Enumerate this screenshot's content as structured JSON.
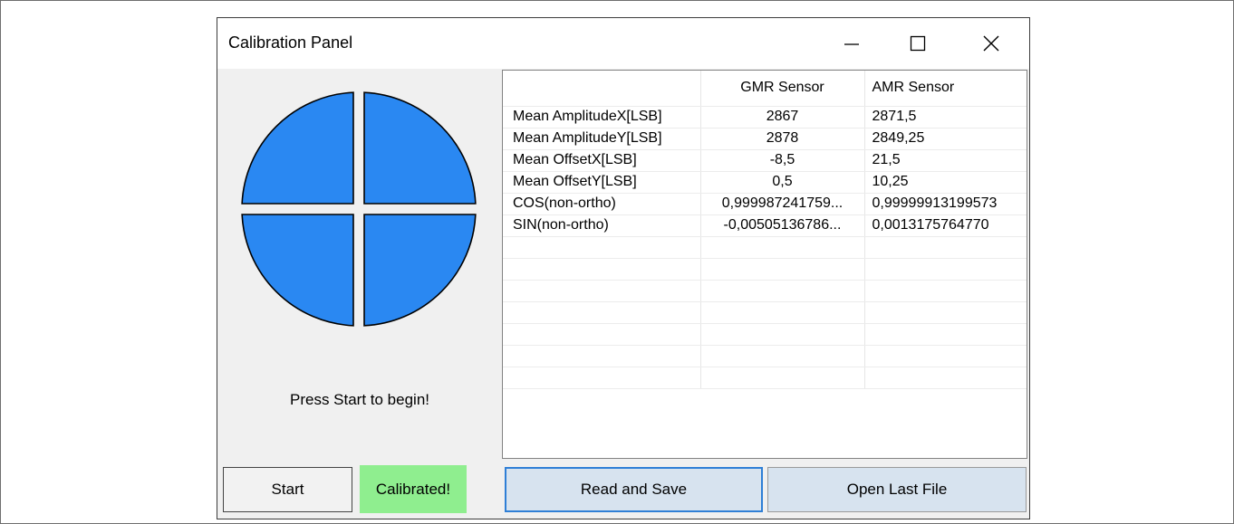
{
  "window": {
    "title": "Calibration Panel",
    "controls": [
      "minimize-icon",
      "maximize-icon",
      "close-icon"
    ]
  },
  "indicator": {
    "fill_color": "#2a88f2",
    "stroke_color": "#000000"
  },
  "status_message": "Press Start to begin!",
  "table": {
    "columns": [
      "",
      "GMR Sensor",
      "AMR Sensor"
    ],
    "rows": [
      [
        "Mean AmplitudeX[LSB]",
        "2867",
        "2871,5"
      ],
      [
        "Mean AmplitudeY[LSB]",
        "2878",
        "2849,25"
      ],
      [
        "Mean OffsetX[LSB]",
        "-8,5",
        "21,5"
      ],
      [
        "Mean OffsetY[LSB]",
        "0,5",
        "10,25"
      ],
      [
        "COS(non-ortho)",
        "0,999987241759...",
        "0,99999913199573"
      ],
      [
        "SIN(non-ortho)",
        "-0,00505136786...",
        "0,0013175764770"
      ]
    ],
    "empty_rows": 7
  },
  "buttons": {
    "start": "Start",
    "status": "Calibrated!",
    "read_save": "Read and Save",
    "open_last": "Open Last File"
  },
  "colors": {
    "status_bg": "#8fee8f",
    "accent_border": "#2f7fd6",
    "button_bg": "#d7e3ef"
  }
}
